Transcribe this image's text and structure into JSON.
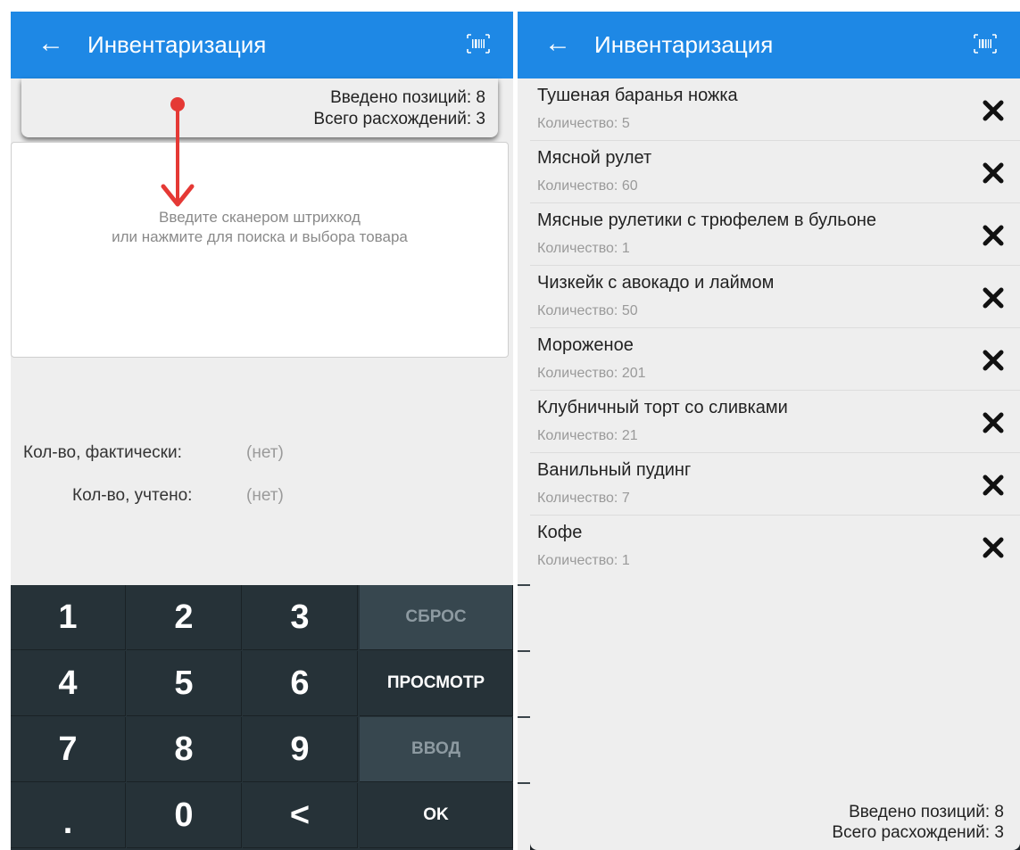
{
  "app": {
    "title": "Инвентаризация"
  },
  "summary": {
    "entered": "Введено позиций: 8",
    "discrepancies": "Всего расхождений: 3"
  },
  "scan": {
    "hint_line1": "Введите сканером штрихкод",
    "hint_line2": "или нажмите для поиска и выбора товара"
  },
  "quantity": {
    "actual_label": "Кол-во, фактически:",
    "actual_value": "(нет)",
    "recorded_label": "Кол-во, учтено:",
    "recorded_value": "(нет)"
  },
  "keypad": {
    "k1": "1",
    "k2": "2",
    "k3": "3",
    "k4": "4",
    "k5": "5",
    "k6": "6",
    "k7": "7",
    "k8": "8",
    "k9": "9",
    "kdot": ".",
    "k0": "0",
    "kback": "<",
    "reset": "СБРОС",
    "view": "ПРОСМОТР",
    "enter": "ВВОД",
    "ok": "OK"
  },
  "items": [
    {
      "name": "Тушеная баранья ножка",
      "count": "Количество: 5"
    },
    {
      "name": "Мясной рулет",
      "count": "Количество: 60"
    },
    {
      "name": "Мясные рулетики с трюфелем в бульоне",
      "count": "Количество: 1"
    },
    {
      "name": "Чизкейк с авокадо и лаймом",
      "count": "Количество: 50"
    },
    {
      "name": "Мороженое",
      "count": "Количество: 201"
    },
    {
      "name": "Клубничный торт со сливками",
      "count": "Количество: 21"
    },
    {
      "name": "Ванильный пудинг",
      "count": "Количество: 7"
    },
    {
      "name": "Кофе",
      "count": "Количество: 1"
    }
  ],
  "icons": {
    "back": "arrow-left-icon",
    "barcode": "barcode-icon",
    "delete": "close-icon",
    "annotation": "arrow-down-icon"
  },
  "colors": {
    "appbar": "#1e88e5",
    "keypad": "#263238",
    "keypad_action": "#37474f",
    "annotation": "#e53935"
  }
}
